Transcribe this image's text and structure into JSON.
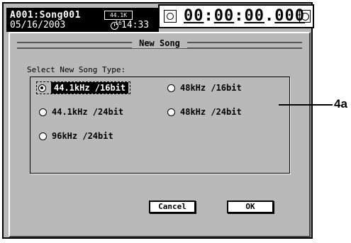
{
  "status": {
    "song_id_name": "A001:Song001",
    "date": "05/16/2003",
    "format_badge": "44.1K 16",
    "time": "14:33",
    "clock_icon": "clock-icon"
  },
  "counter": {
    "value_parts": [
      "00",
      "00",
      "00",
      "000"
    ],
    "display": "00:00:00.000",
    "icon_left": "counter-clock-icon",
    "icon_right": "alarm-icon"
  },
  "dialog": {
    "title": "New Song",
    "prompt": "Select New Song Type:",
    "options": [
      {
        "label": "44.1kHz /16bit",
        "selected": true
      },
      {
        "label": "48kHz /16bit",
        "selected": false
      },
      {
        "label": "44.1kHz /24bit",
        "selected": false
      },
      {
        "label": "48kHz /24bit",
        "selected": false
      },
      {
        "label": "96kHz /24bit",
        "selected": false
      }
    ],
    "cancel_label": "Cancel",
    "ok_label": "OK"
  },
  "annotation": {
    "label": "4a"
  }
}
